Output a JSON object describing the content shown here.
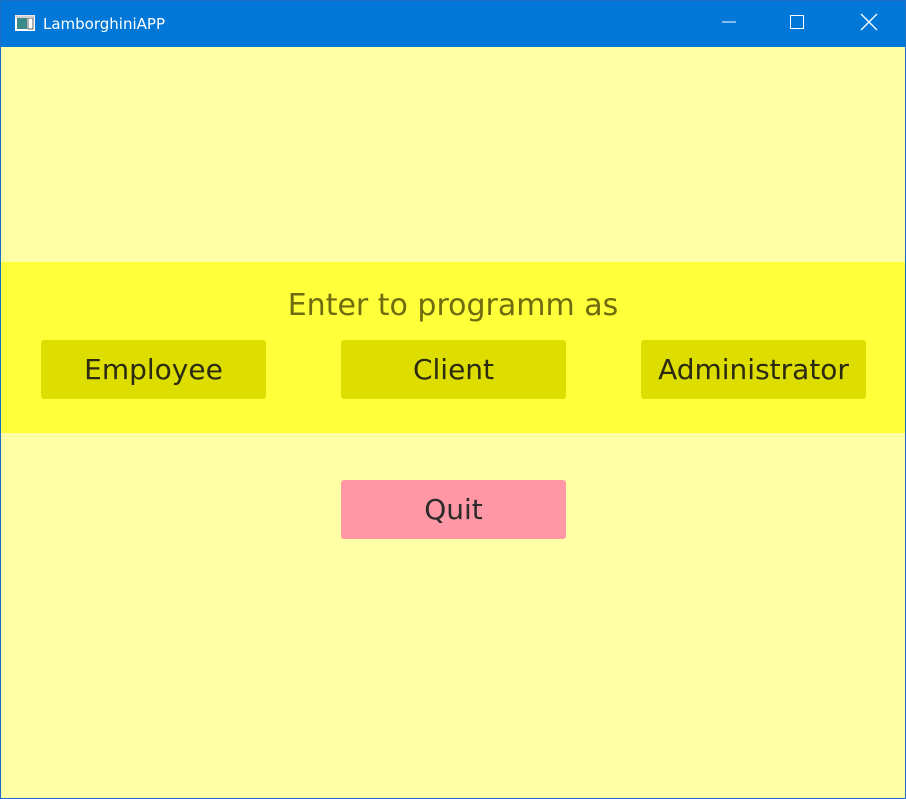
{
  "window": {
    "title": "LamborghiniAPP"
  },
  "main": {
    "prompt": "Enter to programm as",
    "roles": [
      {
        "label": "Employee"
      },
      {
        "label": "Client"
      },
      {
        "label": "Administrator"
      }
    ],
    "quit_label": "Quit"
  },
  "colors": {
    "titlebar": "#0178d7",
    "background": "#ffffa6",
    "band": "#ffff3a",
    "role_button": "#dedd00",
    "quit_button": "#ff98a4",
    "prompt_text": "#6f6b0f"
  },
  "icons": {
    "app": "app-window-icon",
    "minimize": "minimize-icon",
    "maximize": "maximize-icon",
    "close": "close-icon"
  }
}
